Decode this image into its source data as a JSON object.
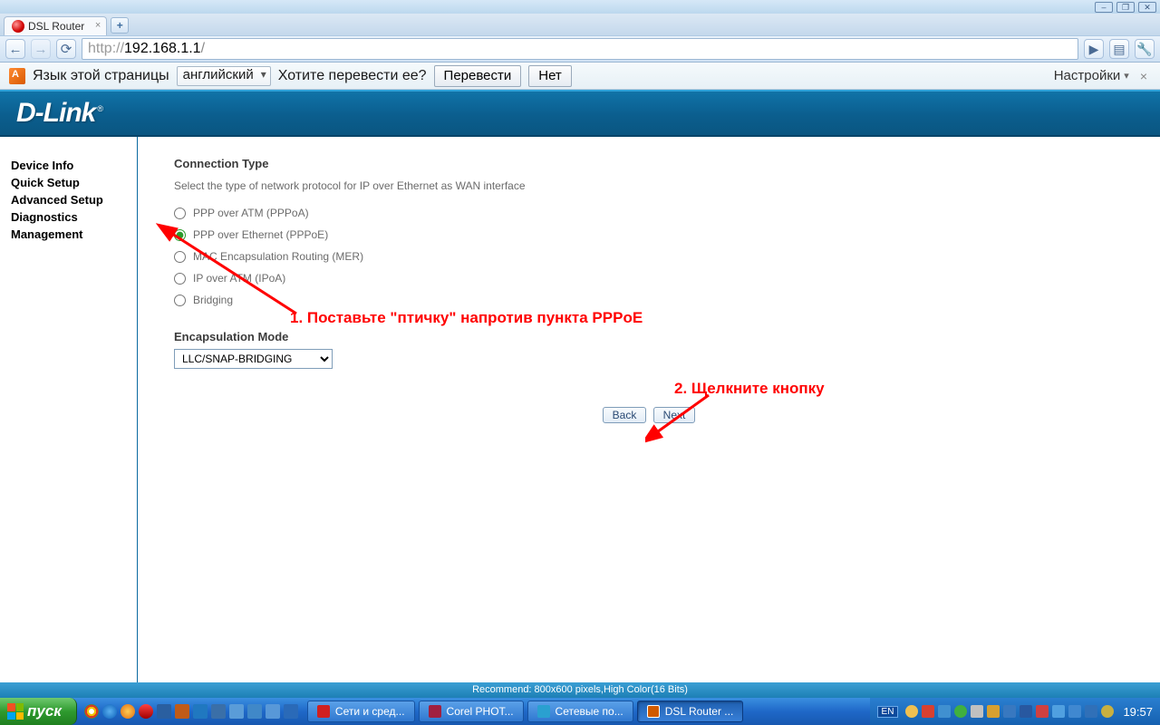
{
  "window_controls": {
    "min": "–",
    "max": "❐",
    "close": "✕"
  },
  "browser": {
    "tab_title": "DSL Router",
    "newtab": "+",
    "nav": {
      "back": "←",
      "forward": "→",
      "reload": "⟳"
    },
    "url_proto": "http://",
    "url_host": "192.168.1.1",
    "url_path": "/",
    "right_tools": {
      "play": "▶",
      "page": "▤",
      "wrench": "🔧"
    }
  },
  "translate": {
    "prompt": "Язык этой страницы",
    "lang_selected": "английский",
    "question": "Хотите перевести ее?",
    "btn_translate": "Перевести",
    "btn_no": "Нет",
    "settings": "Настройки",
    "close": "×"
  },
  "router": {
    "brand": "D-Link",
    "reg": "®",
    "sidebar": [
      "Device Info",
      "Quick Setup",
      "Advanced Setup",
      "Diagnostics",
      "Management"
    ],
    "heading": "Connection Type",
    "desc": "Select the type of network protocol for IP over Ethernet as WAN interface",
    "options": [
      {
        "label": "PPP over ATM (PPPoA)",
        "selected": false
      },
      {
        "label": "PPP over Ethernet (PPPoE)",
        "selected": true
      },
      {
        "label": "MAC Encapsulation Routing (MER)",
        "selected": false
      },
      {
        "label": "IP over ATM (IPoA)",
        "selected": false
      },
      {
        "label": "Bridging",
        "selected": false
      }
    ],
    "enc_label": "Encapsulation Mode",
    "enc_value": "LLC/SNAP-BRIDGING",
    "btn_back": "Back",
    "btn_next": "Next",
    "recommend": "Recommend: 800x600 pixels,High Color(16 Bits)"
  },
  "annotations": {
    "step1": "1. Поставьте \"птичку\" напротив пункта PPPoE",
    "step2": "2. Щелкните кнопку"
  },
  "taskbar": {
    "start": "пуск",
    "tasks": [
      {
        "label": "Сети и сред...",
        "color": "#d02020"
      },
      {
        "label": "Corel PHOT...",
        "color": "#a02040"
      },
      {
        "label": "Сетевые по...",
        "color": "#2aa0d0"
      },
      {
        "label": "DSL Router ...",
        "color": "#d05a00",
        "active": true
      }
    ],
    "lang": "EN",
    "clock": "19:57"
  }
}
